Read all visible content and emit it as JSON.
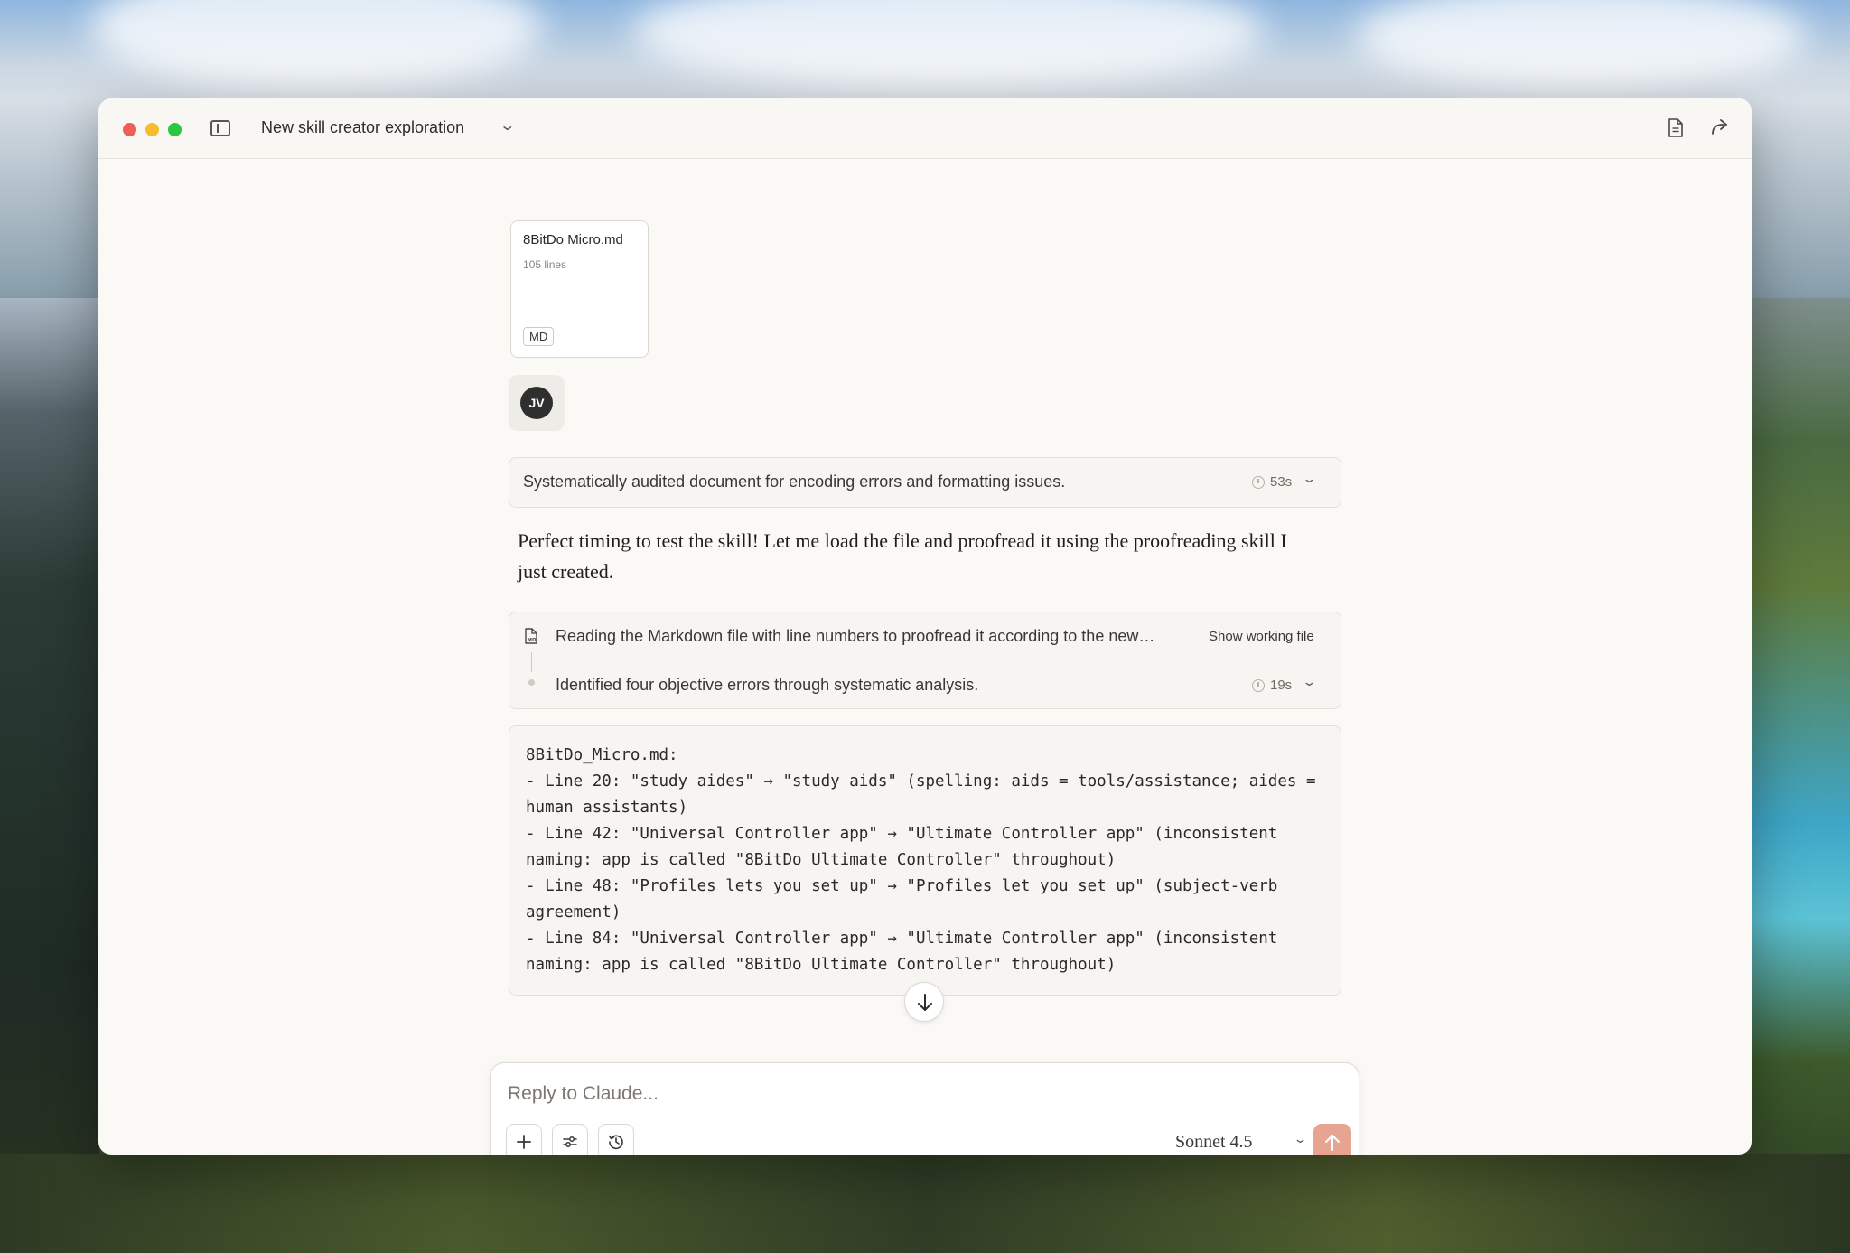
{
  "window": {
    "title": "New skill creator exploration"
  },
  "attachment": {
    "name": "8BitDo Micro.md",
    "lines": "105 lines",
    "badge": "MD"
  },
  "user": {
    "initials": "JV"
  },
  "thinking": {
    "summary": "Systematically audited document for encoding errors and formatting issues.",
    "duration": "53s"
  },
  "assistant": {
    "reply": "Perfect timing to test the skill! Let me load the file and proofread it using the proofreading skill I just created."
  },
  "tool_steps": {
    "step1": "Reading the Markdown file with line numbers to proofread it according to the new…",
    "step1_action": "Show working file",
    "step2": "Identified four objective errors through systematic analysis.",
    "step2_duration": "19s"
  },
  "code_output": "8BitDo_Micro.md:\n- Line 20: \"study aides\" → \"study aids\" (spelling: aids = tools/assistance; aides = human assistants)\n- Line 42: \"Universal Controller app\" → \"Ultimate Controller app\" (inconsistent naming: app is called \"8BitDo Ultimate Controller\" throughout)\n- Line 48: \"Profiles lets you set up\" → \"Profiles let you set up\" (subject-verb agreement)\n- Line 84: \"Universal Controller app\" → \"Ultimate Controller app\" (inconsistent naming: app is called \"8BitDo Ultimate Controller\" throughout)",
  "composer": {
    "placeholder": "Reply to Claude...",
    "model": "Sonnet 4.5"
  },
  "icons": {
    "traffic_lights": [
      "close",
      "minimize",
      "zoom"
    ],
    "toolbar": [
      "sidebar-toggle-icon",
      "chevron-down-icon",
      "document-icon",
      "share-icon"
    ],
    "composer": [
      "plus-icon",
      "sliders-icon",
      "history-icon",
      "arrow-up-icon"
    ]
  },
  "colors": {
    "send_button": "#e7a591",
    "window_bg": "#faf9f6"
  }
}
